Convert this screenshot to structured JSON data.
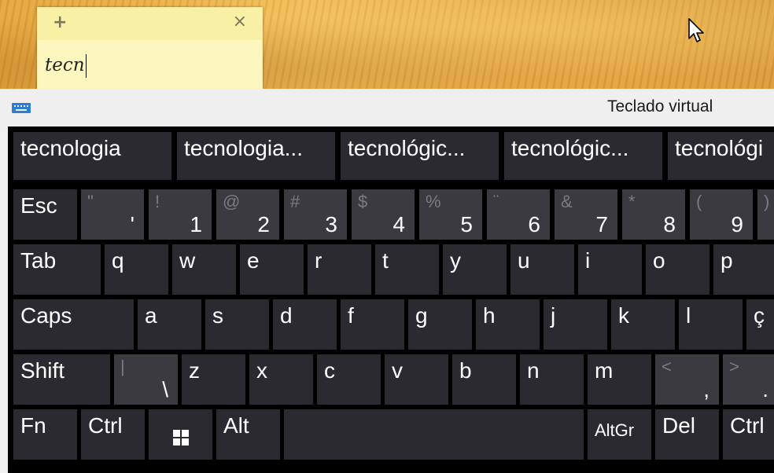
{
  "sticky_note": {
    "add_symbol": "+",
    "close_symbol": "×",
    "text": "tecn"
  },
  "osk": {
    "title": "Teclado virtual",
    "icon": "keyboard-icon",
    "suggestions": [
      "tecnologia",
      "tecnologia...",
      "tecnológic...",
      "tecnológic...",
      "tecnológi"
    ],
    "rows": {
      "numbers": [
        {
          "main": "Esc"
        },
        {
          "sec": "\"",
          "shift": "'"
        },
        {
          "sec": "!",
          "shift": "1"
        },
        {
          "sec": "@",
          "shift": "2"
        },
        {
          "sec": "#",
          "shift": "3"
        },
        {
          "sec": "$",
          "shift": "4"
        },
        {
          "sec": "%",
          "shift": "5"
        },
        {
          "sec": "¨",
          "shift": "6"
        },
        {
          "sec": "&",
          "shift": "7"
        },
        {
          "sec": "*",
          "shift": "8"
        },
        {
          "sec": "(",
          "shift": "9"
        },
        {
          "sec": ")",
          "shift": ""
        }
      ],
      "qwerty": [
        "Tab",
        "q",
        "w",
        "e",
        "r",
        "t",
        "y",
        "u",
        "i",
        "o",
        "p"
      ],
      "home": [
        "Caps",
        "a",
        "s",
        "d",
        "f",
        "g",
        "h",
        "j",
        "k",
        "l",
        "ç"
      ],
      "shift": [
        {
          "main": "Shift"
        },
        {
          "sec": "|",
          "shift": "\\"
        },
        {
          "main": "z"
        },
        {
          "main": "x"
        },
        {
          "main": "c"
        },
        {
          "main": "v"
        },
        {
          "main": "b"
        },
        {
          "main": "n"
        },
        {
          "main": "m"
        },
        {
          "sec": "<",
          "shift": ","
        },
        {
          "sec": ">",
          "shift": "."
        }
      ],
      "bottom": [
        "Fn",
        "Ctrl",
        "",
        "Alt",
        "",
        "AltGr",
        "Del",
        "Ctrl"
      ]
    }
  }
}
